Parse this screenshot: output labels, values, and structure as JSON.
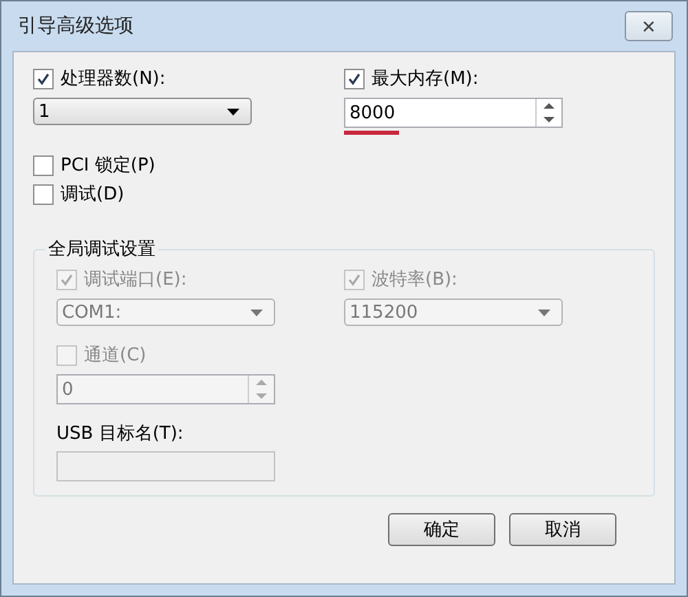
{
  "window": {
    "title": "引导高级选项",
    "close": "✕"
  },
  "processors": {
    "label": "处理器数(N):",
    "checked": true,
    "disabled": false,
    "value": "1"
  },
  "max_memory": {
    "label": "最大内存(M):",
    "checked": true,
    "disabled": false,
    "value": "8000"
  },
  "options": [
    {
      "label": "PCI 锁定(P)",
      "checked": false,
      "disabled": false
    },
    {
      "label": "调试(D)",
      "checked": false,
      "disabled": false
    }
  ],
  "debug_group": {
    "title": "全局调试设置",
    "port": {
      "label": "调试端口(E):",
      "checked": true,
      "disabled": true,
      "value": "COM1:"
    },
    "baud": {
      "label": "波特率(B):",
      "checked": true,
      "disabled": true,
      "value": "115200"
    },
    "channel": {
      "label": "通道(C)",
      "checked": false,
      "disabled": true,
      "value": "0"
    },
    "usb": {
      "label": "USB 目标名(T):",
      "disabled": true
    }
  },
  "buttons": [
    "确定",
    "取消"
  ]
}
